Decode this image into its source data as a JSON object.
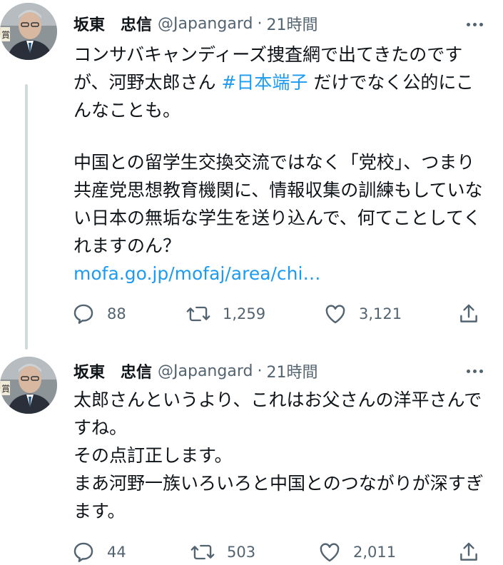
{
  "tweets": [
    {
      "author_name": "坂東　忠信",
      "handle": "@Japangard",
      "separator": "·",
      "time": "21時間",
      "text_intro": "コンサバキャンディーズ捜査網で出てきたのですが、河野太郎さん ",
      "hashtag": "#日本端子",
      "text_after_hashtag": " だけでなく公的にこんなことも。",
      "text_main": "中国との留学生交換交流ではなく「党校」、つまり共産党思想教育機関に、情報収集の訓練もしていない日本の無垢な学生を送り込んで、何てことしてくれますのん？",
      "link": "mofa.go.jp/mofaj/area/chi…",
      "reply_count": "88",
      "retweet_count": "1,259",
      "like_count": "3,121",
      "avatar_badge": "賞"
    },
    {
      "author_name": "坂東　忠信",
      "handle": "@Japangard",
      "separator": "·",
      "time": "21時間",
      "text": "太郎さんというより、これはお父さんの洋平さんですね。\nその点訂正します。\nまあ河野一族いろいろと中国とのつながりが深すぎます。",
      "reply_count": "44",
      "retweet_count": "503",
      "like_count": "2,011",
      "avatar_badge": "賞"
    }
  ],
  "colors": {
    "link": "#1d9bf0",
    "muted": "#536471",
    "text": "#0f1419",
    "thread_line": "#cfd9de"
  },
  "icons": [
    "reply-icon",
    "retweet-icon",
    "like-icon",
    "share-icon",
    "more-icon"
  ]
}
